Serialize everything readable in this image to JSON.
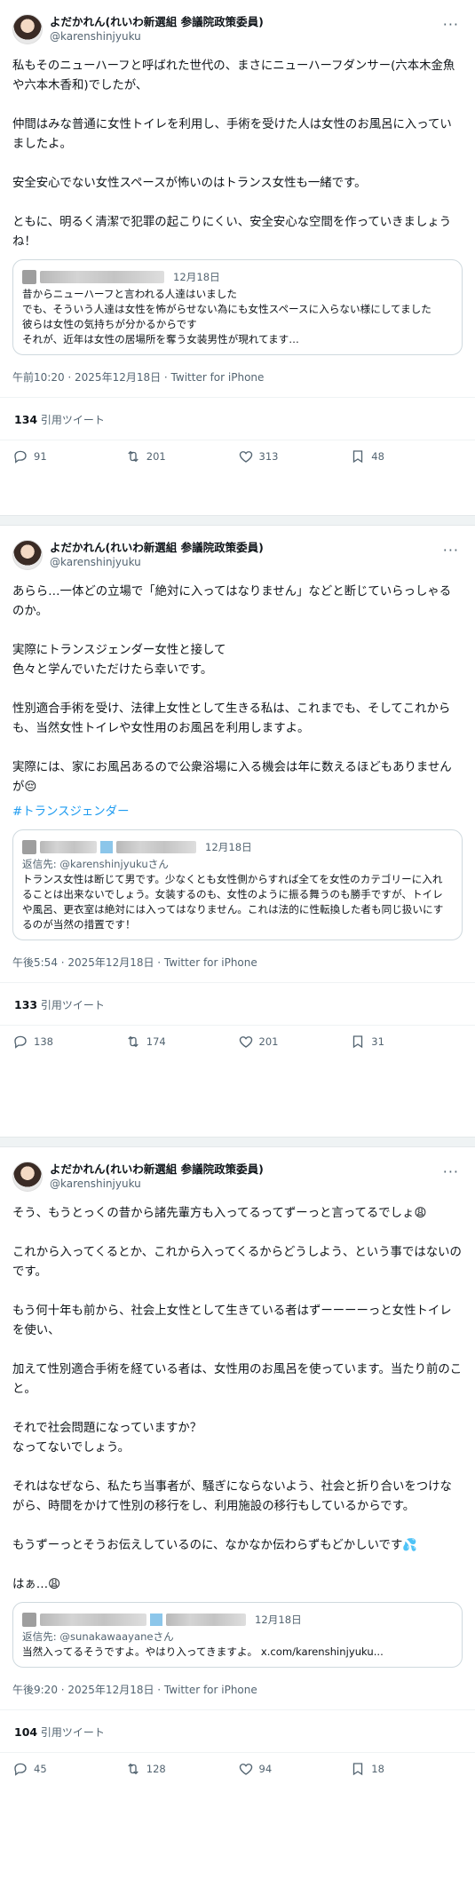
{
  "tweets": [
    {
      "display_name": "よだかれん(れいわ新選組 参議院政策委員)",
      "handle": "@karenshinjyuku",
      "body": "私もそのニューハーフと呼ばれた世代の、まさにニューハーフダンサー(六本木金魚や六本木香和)でしたが、\n\n仲間はみな普通に女性トイレを利用し、手術を受けた人は女性のお風呂に入っていましたよ。\n\n安全安心でない女性スペースが怖いのはトランス女性も一緒です。\n\nともに、明るく清潔で犯罪の起こりにくい、安全安心な空間を作っていきましょうね！",
      "hashtag": "",
      "quote": {
        "date": "12月18日",
        "reply_to": "",
        "text": "昔からニューハーフと言われる人達はいました\nでも、そういう人達は女性を怖がらせない為にも女性スペースに入らない様にしてました\n彼らは女性の気持ちが分かるからです\nそれが、近年は女性の居場所を奪う女装男性が現れてます…"
      },
      "meta": "午前10:20 · 2025年12月18日 · Twitter for iPhone",
      "quote_count": "134",
      "quote_label": "引用ツイート",
      "replies": "91",
      "retweets": "201",
      "likes": "313",
      "bookmarks": "48"
    },
    {
      "display_name": "よだかれん(れいわ新選組 参議院政策委員)",
      "handle": "@karenshinjyuku",
      "body": "あらら…一体どの立場で「絶対に入ってはなりません」などと断じていらっしゃるのか。\n\n実際にトランスジェンダー女性と接して\n色々と学んでいただけたら幸いです。\n\n性別適合手術を受け、法律上女性として生きる私は、これまでも、そしてこれからも、当然女性トイレや女性用のお風呂を利用しますよ。\n\n実際には、家にお風呂あるので公衆浴場に入る機会は年に数えるほどもありませんが😔",
      "hashtag": "#トランスジェンダー",
      "quote": {
        "date": "12月18日",
        "reply_to": "返信先: @karenshinjyukuさん",
        "text": "トランス女性は断じて男です。少なくとも女性側からすれば全てを女性のカテゴリーに入れることは出来ないでしょう。女装するのも、女性のように振る舞うのも勝手ですが、トイレや風呂、更衣室は絶対には入ってはなりません。これは法的に性転換した者も同じ扱いにするのが当然の措置です！"
      },
      "meta": "午後5:54 · 2025年12月18日 · Twitter for iPhone",
      "quote_count": "133",
      "quote_label": "引用ツイート",
      "replies": "138",
      "retweets": "174",
      "likes": "201",
      "bookmarks": "31"
    },
    {
      "display_name": "よだかれん(れいわ新選組 参議院政策委員)",
      "handle": "@karenshinjyuku",
      "body": "そう、もうとっくの昔から諸先輩方も入ってるってずーっと言ってるでしょ😩\n\nこれから入ってくるとか、これから入ってくるからどうしよう、という事ではないのです。\n\nもう何十年も前から、社会上女性として生きている者はずーーーーっと女性トイレを使い、\n\n加えて性別適合手術を経ている者は、女性用のお風呂を使っています。当たり前のこと。\n\nそれで社会問題になっていますか？\nなってないでしょう。\n\nそれはなぜなら、私たち当事者が、騒ぎにならないよう、社会と折り合いをつけながら、時間をかけて性別の移行をし、利用施設の移行もしているからです。\n\nもうずーっとそうお伝えしているのに、なかなか伝わらずもどかしいです💦\n\nはぁ…😩",
      "hashtag": "",
      "quote": {
        "date": "12月18日",
        "reply_to": "返信先: @sunakawaayaneさん",
        "text": "当然入ってるそうですよ。やはり入ってきますよ。 x.com/karenshinjyuku..."
      },
      "meta": "午後9:20 · 2025年12月18日 · Twitter for iPhone",
      "quote_count": "104",
      "quote_label": "引用ツイート",
      "replies": "45",
      "retweets": "128",
      "likes": "94",
      "bookmarks": "18"
    }
  ],
  "icons": {
    "more": "more-dots-icon",
    "reply": "reply-bubble-icon",
    "retweet": "retweet-icon",
    "like": "heart-icon",
    "bookmark": "bookmark-icon"
  },
  "colors": {
    "text": "#0f1419",
    "secondary": "#536471",
    "link": "#1d9bf0",
    "border": "#cfd9de",
    "separator": "#eff3f4"
  }
}
